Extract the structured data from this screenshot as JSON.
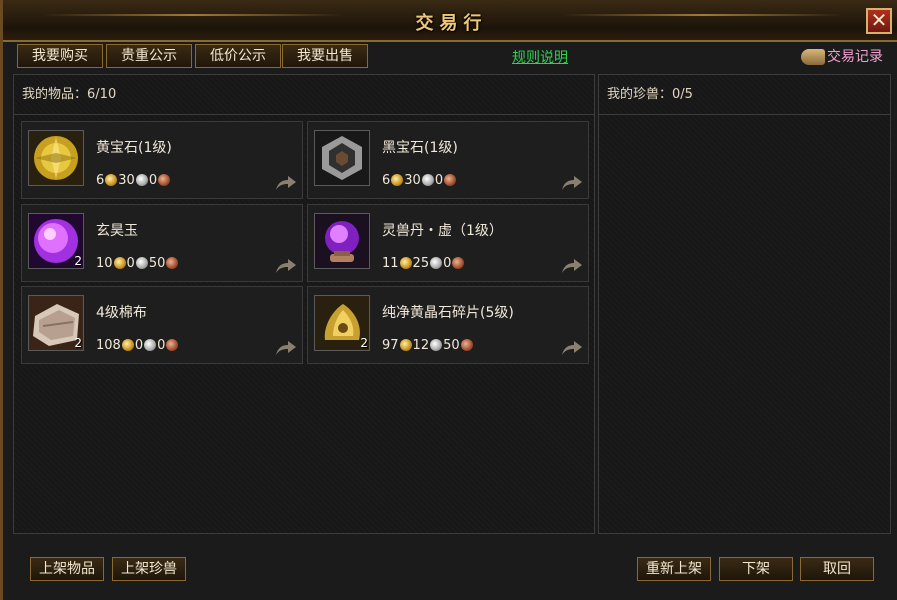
{
  "window": {
    "title": "交易行",
    "close_label": "✕"
  },
  "tabs": [
    {
      "label": "我要购买"
    },
    {
      "label": "贵重公示"
    },
    {
      "label": "低价公示"
    },
    {
      "label": "我要出售"
    }
  ],
  "rules_link": "规则说明",
  "trade_record": "交易记录",
  "my_items": {
    "label": "我的物品：",
    "count": "6/10",
    "items": [
      {
        "name": "黄宝石(1级)",
        "gold": "6",
        "silver": "30",
        "copper": "0",
        "count": "",
        "icon": "yellow-gem-icon"
      },
      {
        "name": "黑宝石(1级)",
        "gold": "6",
        "silver": "30",
        "copper": "0",
        "count": "",
        "icon": "black-gem-icon"
      },
      {
        "name": "玄昊玉",
        "gold": "10",
        "silver": "0",
        "copper": "50",
        "count": "2",
        "icon": "purple-jade-icon"
      },
      {
        "name": "灵兽丹・虚（1级）",
        "gold": "11",
        "silver": "25",
        "copper": "0",
        "count": "",
        "icon": "crystal-ball-icon"
      },
      {
        "name": "4级棉布",
        "gold": "108",
        "silver": "0",
        "copper": "0",
        "count": "2",
        "icon": "cloth-icon"
      },
      {
        "name": "纯净黄晶石碎片(5级)",
        "gold": "97",
        "silver": "12",
        "copper": "50",
        "count": "2",
        "icon": "crystal-shard-icon"
      }
    ]
  },
  "my_pets": {
    "label": "我的珍兽：",
    "count": "0/5"
  },
  "buttons": {
    "list_item": "上架物品",
    "list_pet": "上架珍兽",
    "relist": "重新上架",
    "delist": "下架",
    "cancel": "取回"
  },
  "colors": {
    "accent": "#f0c878",
    "link": "#30d050",
    "record": "#f0a0d0"
  }
}
